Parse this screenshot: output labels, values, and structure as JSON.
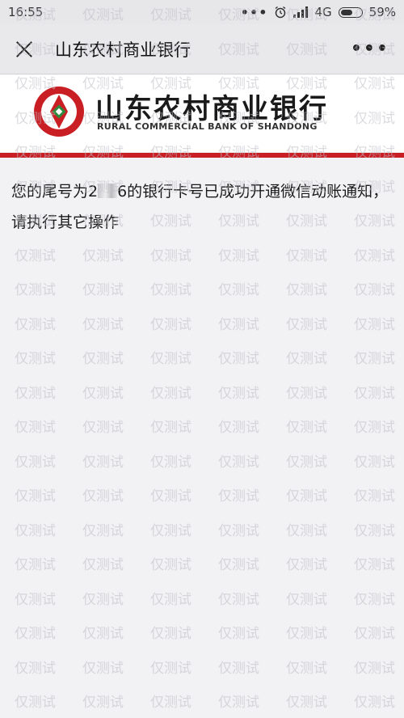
{
  "status_bar": {
    "time": "16:55",
    "more": "•••",
    "network": "4G",
    "battery_text": "59%",
    "battery_level": 0.59
  },
  "nav": {
    "title": "山东农村商业银行",
    "more_label": "•••"
  },
  "banner": {
    "bank_name_cn": "山东农村商业银行",
    "bank_name_en": "RURAL COMMERCIAL BANK OF SHANDONG",
    "accent_color": "#c81e24"
  },
  "message": {
    "before_mask": "您的尾号为2",
    "after_mask": "6的银行卡号已成功开通微信动账通知，请执行其它操作"
  },
  "watermark": {
    "text": "仅测试"
  },
  "icons": {
    "close": "close-icon",
    "more": "more-icon",
    "alarm": "alarm-icon",
    "signal": "signal-icon",
    "battery": "battery-icon",
    "logo": "bank-logo-icon"
  }
}
